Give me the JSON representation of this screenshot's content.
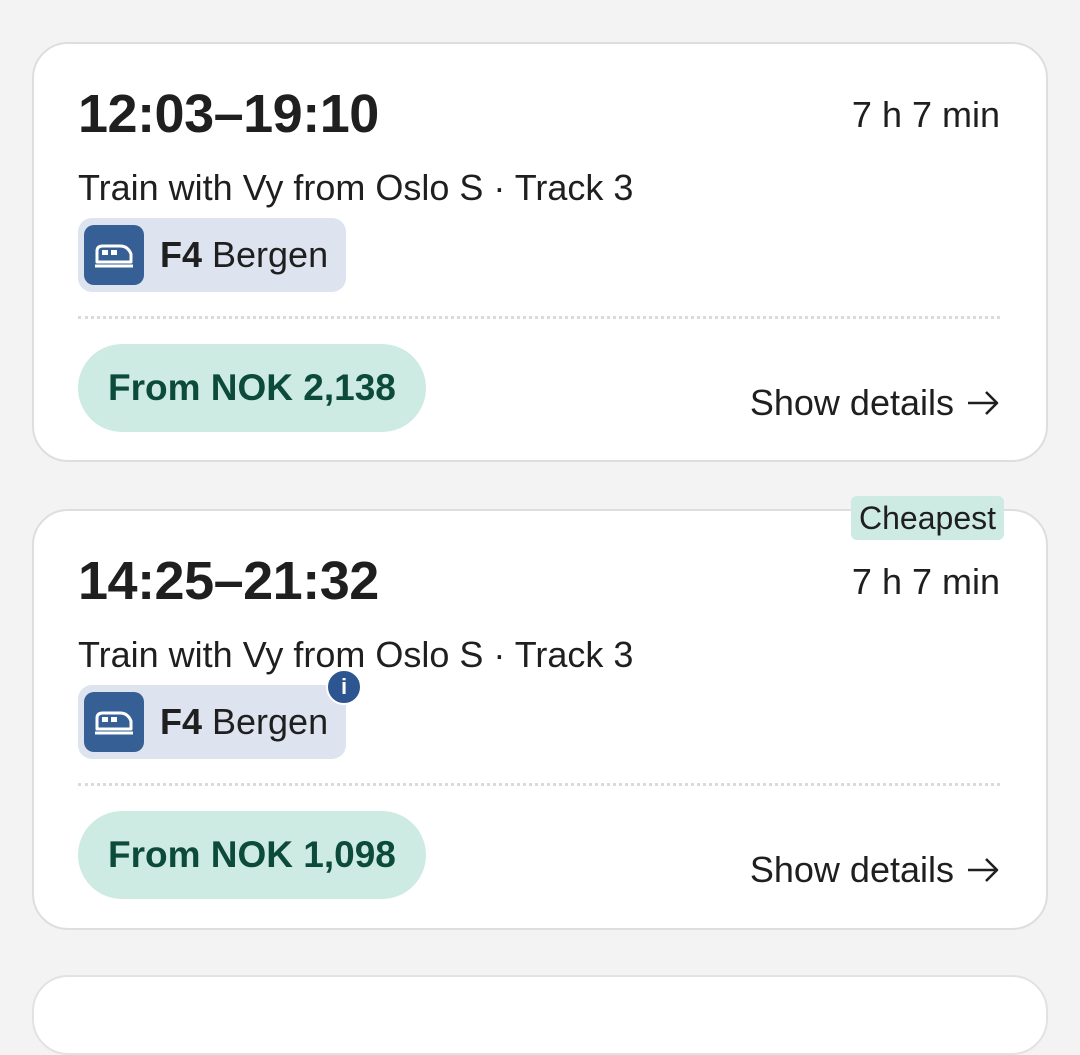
{
  "journeys": [
    {
      "times": "12:03–19:10",
      "duration": "7 h 7 min",
      "route": "Train with Vy from Oslo S · Track 3",
      "line_code": "F4",
      "line_destination": "Bergen",
      "price": "From NOK 2,138",
      "details_label": "Show details",
      "has_info_badge": false
    },
    {
      "times": "14:25–21:32",
      "duration": "7 h 7 min",
      "route": "Train with Vy from Oslo S · Track 3",
      "line_code": "F4",
      "line_destination": "Bergen",
      "price": "From NOK 1,098",
      "details_label": "Show details",
      "badge": "Cheapest",
      "info_badge": "i",
      "has_info_badge": true
    }
  ],
  "icons": {
    "train": "train-icon",
    "arrow": "arrow-right-icon",
    "info": "info-icon"
  },
  "colors": {
    "price_pill_bg": "#cdebe3",
    "price_text": "#0c4a3a",
    "line_chip_bg": "#dde3ef",
    "line_icon_bg": "#365f96",
    "info_badge_bg": "#2d5590"
  }
}
